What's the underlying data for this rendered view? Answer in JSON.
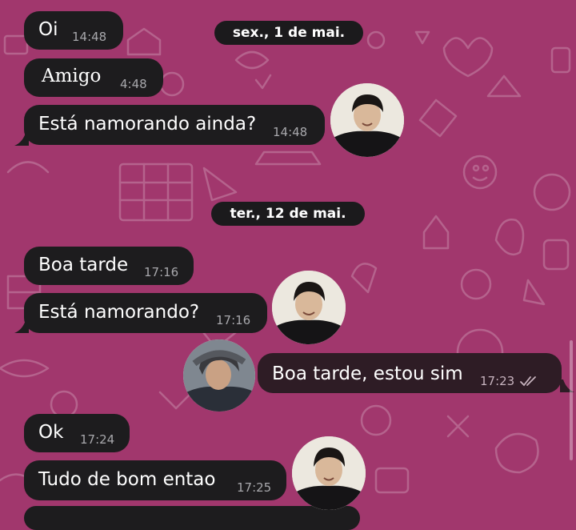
{
  "dates": {
    "date1": "sex., 1 de mai.",
    "date2": "ter., 12 de mai."
  },
  "messages": [
    {
      "text": "Oi",
      "time": "14:48"
    },
    {
      "text": "Amigo",
      "time": "4:48"
    },
    {
      "text": "Está namorando ainda?",
      "time": "14:48"
    },
    {
      "text": "Boa tarde",
      "time": "17:16"
    },
    {
      "text": "Está namorando?",
      "time": "17:16"
    },
    {
      "text": "Boa tarde, estou sim",
      "time": "17:23"
    },
    {
      "text": "Ok",
      "time": "17:24"
    },
    {
      "text": "Tudo de bom entao",
      "time": "17:25"
    }
  ],
  "icons": {
    "read_receipt": "double-check-icon",
    "avatar_contact": "contact-avatar",
    "avatar_self": "self-avatar"
  },
  "colors": {
    "background": "#a1376d",
    "incoming_bubble": "#1d1c1e",
    "outgoing_bubble": "#2e1c25",
    "time": "#a8a8ac"
  }
}
